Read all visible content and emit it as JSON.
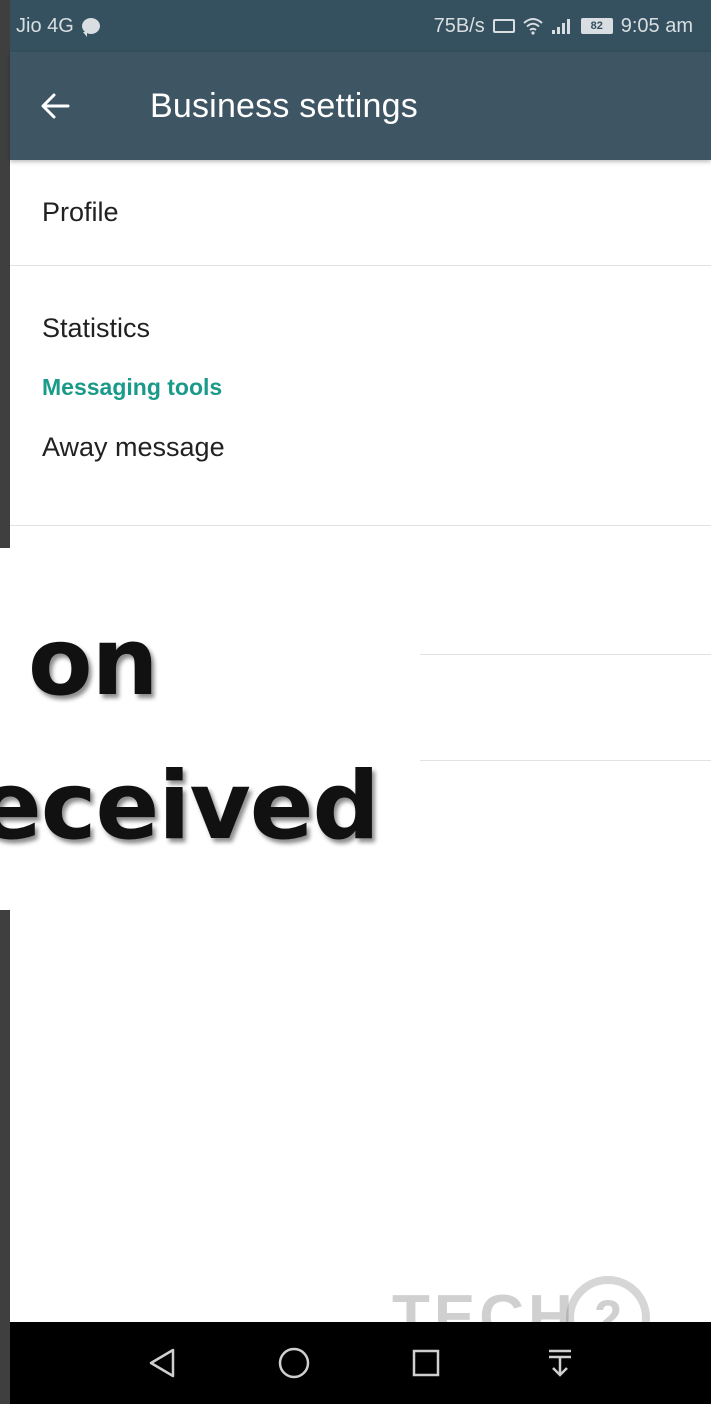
{
  "status_bar": {
    "carrier": "Jio 4G",
    "speed": "75B/s",
    "battery": "82",
    "time": "9:05 am"
  },
  "app_bar": {
    "title": "Business settings"
  },
  "settings": {
    "items": [
      {
        "label": "Profile"
      },
      {
        "label": "Statistics"
      }
    ],
    "section_header": "Messaging tools",
    "away_label": "Away message"
  },
  "overlay": {
    "line1": "on",
    "line2": "eceived"
  },
  "watermark": {
    "text": "TECH",
    "number": "2"
  },
  "colors": {
    "app_bar": "#3e5664",
    "status_bar": "#35505e",
    "section_accent": "#1a9a89",
    "nav_bar": "#000000"
  },
  "icons": {
    "back": "arrow-left-icon",
    "nav_back": "triangle-back-icon",
    "nav_home": "circle-home-icon",
    "nav_recents": "square-recents-icon",
    "nav_notifications": "pull-down-icon"
  }
}
